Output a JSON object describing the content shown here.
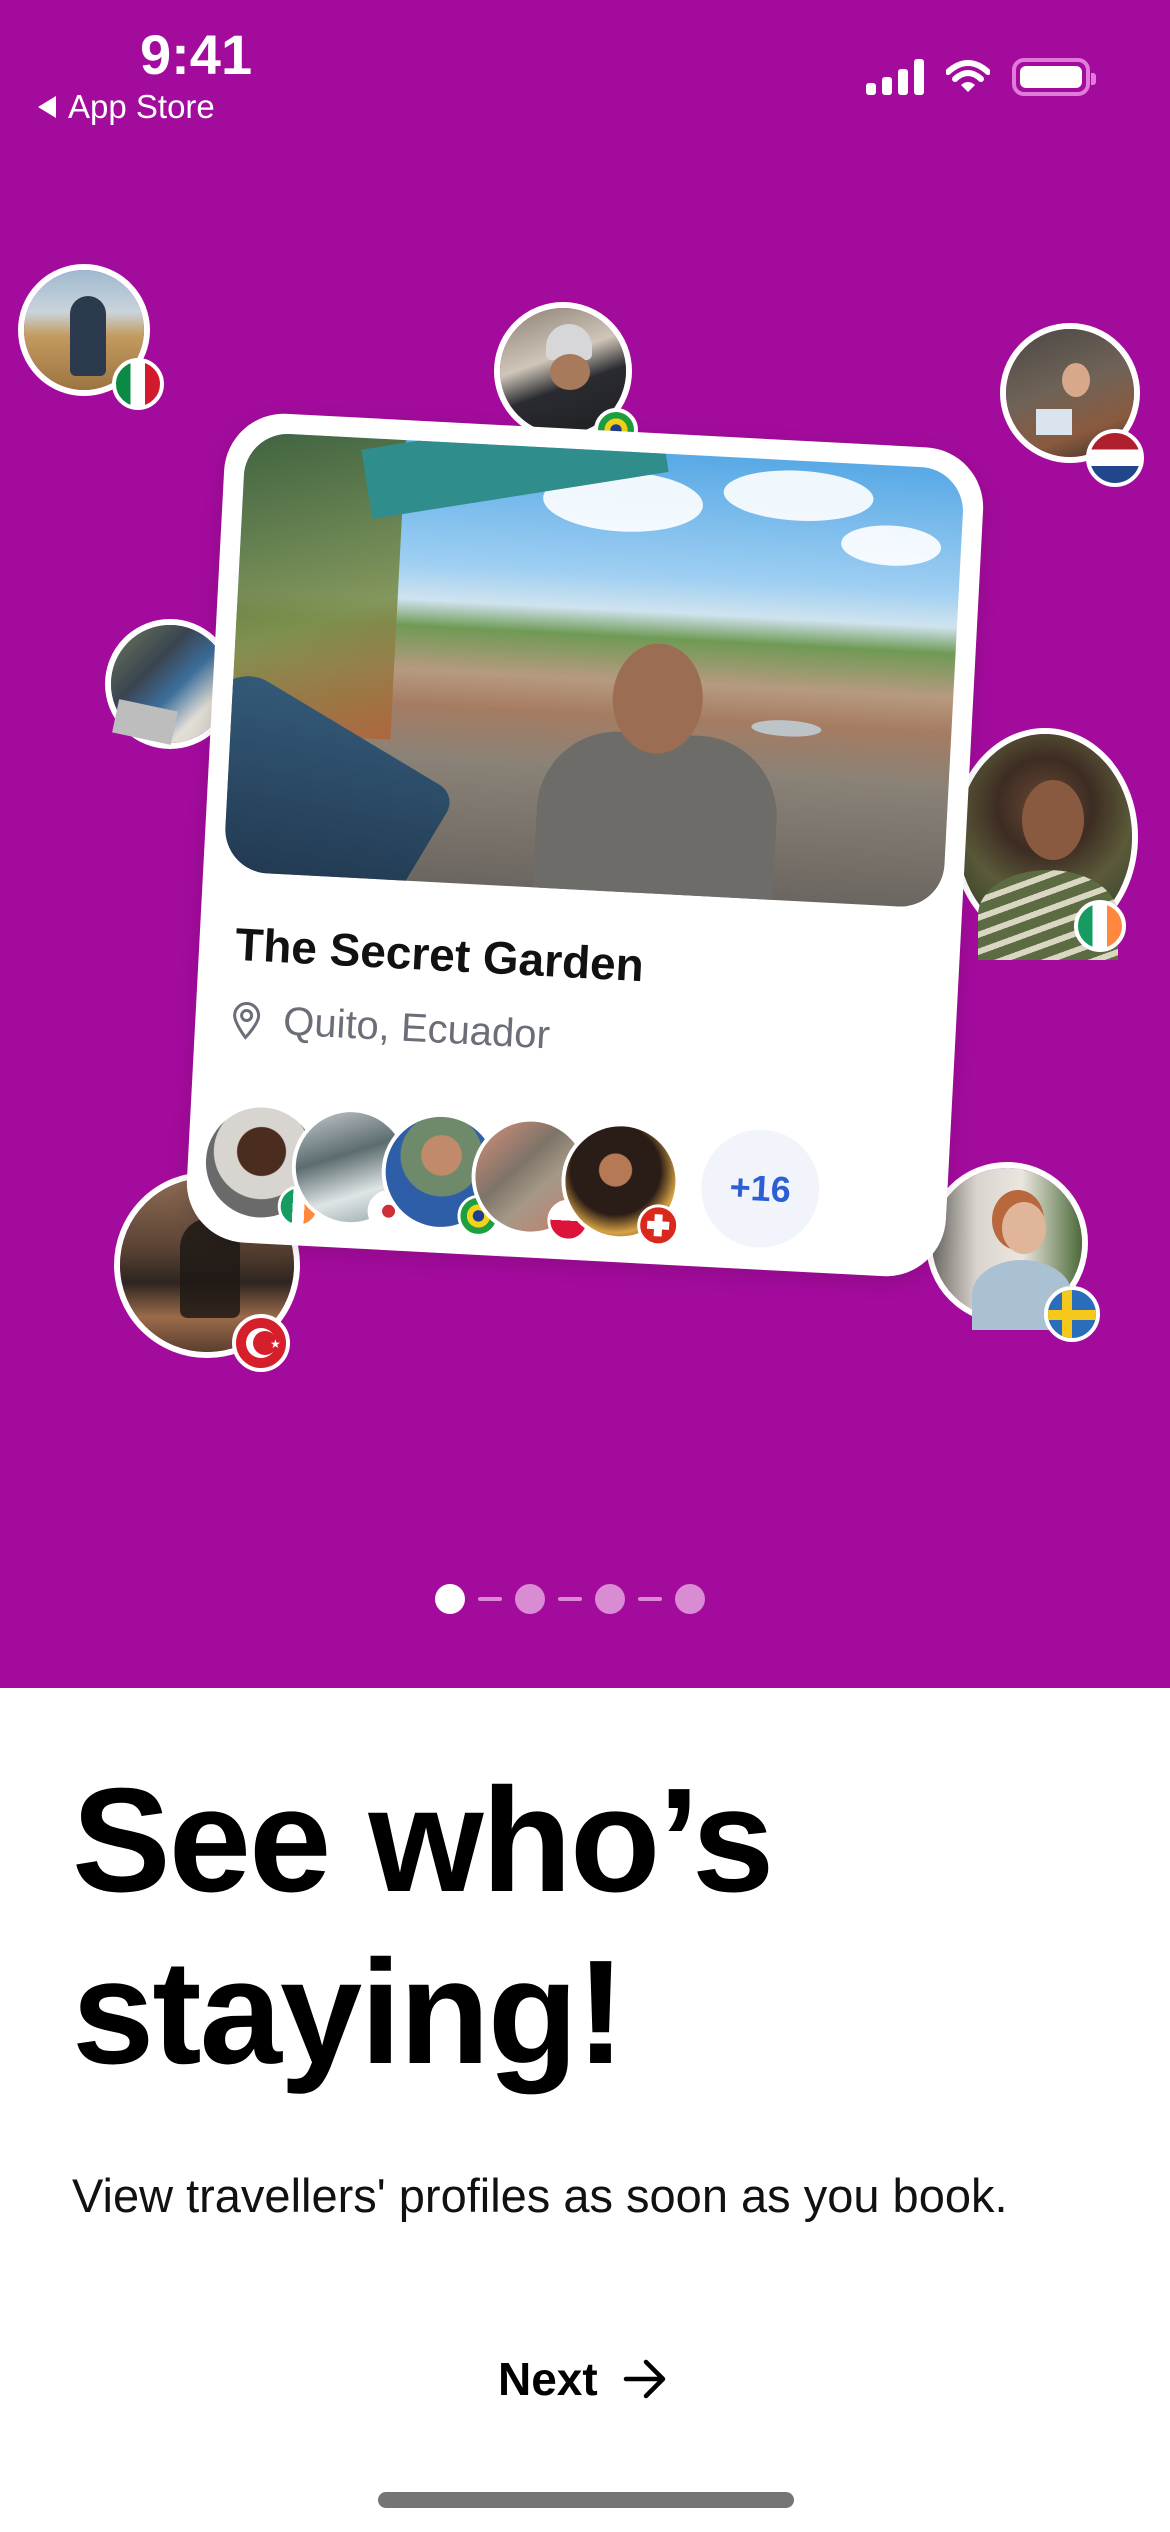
{
  "status_bar": {
    "time": "9:41",
    "back_label": "App Store",
    "icons": [
      "cellular-signal-icon",
      "wifi-icon",
      "battery-icon"
    ]
  },
  "colors": {
    "hero_background": "#a30b9c",
    "accent_blue": "#2d5fd4",
    "pager_inactive": "#d98bd4",
    "pager_active": "#ffffff"
  },
  "floating_avatars": [
    {
      "name": "traveller-field",
      "flag": "Mexico"
    },
    {
      "name": "traveller-eating",
      "flag": "Brazil"
    },
    {
      "name": "travellers-laptop-group",
      "flag": "Netherlands"
    },
    {
      "name": "traveller-laptop",
      "flag": null
    },
    {
      "name": "traveller-smiling-woman",
      "flag": "Ireland"
    },
    {
      "name": "traveller-yoga",
      "flag": "Turkey"
    },
    {
      "name": "traveller-redhead",
      "flag": "Sweden"
    }
  ],
  "property_card": {
    "title": "The Secret Garden",
    "location": "Quito, Ecuador",
    "location_icon": "map-pin-icon",
    "guests": [
      {
        "flag": "Ireland"
      },
      {
        "flag": "South Korea"
      },
      {
        "flag": "Brazil"
      },
      {
        "flag": "Poland"
      },
      {
        "flag": "Switzerland"
      }
    ],
    "more_guests": "+16"
  },
  "pager": {
    "total": 4,
    "current": 1
  },
  "onboarding": {
    "headline_line1": "See who’s",
    "headline_line2": "staying!",
    "subtitle": "View travellers' profiles as soon as you book.",
    "next_label": "Next",
    "next_icon": "arrow-right-icon"
  }
}
